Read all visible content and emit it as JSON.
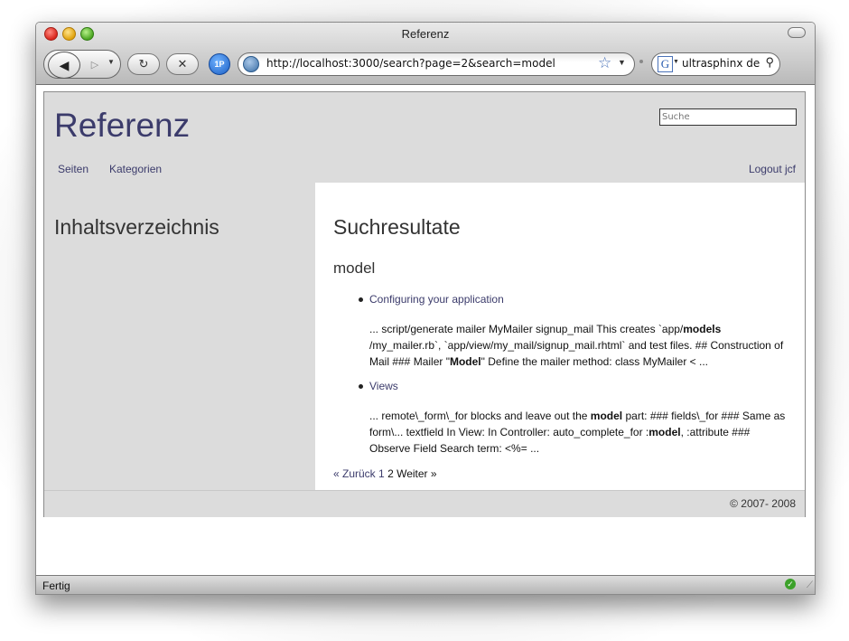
{
  "window": {
    "title": "Referenz",
    "status": "Fertig"
  },
  "toolbar": {
    "url": "http://localhost:3000/search?page=2&search=model",
    "search_value": "ultrasphinx de",
    "onepassword_label": "1P",
    "google_label": "G"
  },
  "site": {
    "logo": "Referenz",
    "search_placeholder": "Suche",
    "nav": {
      "seiten": "Seiten",
      "kategorien": "Kategorien",
      "logout": "Logout jcf"
    },
    "sidebar_title": "Inhaltsverzeichnis",
    "heading": "Suchresultate",
    "query": "model",
    "results": [
      {
        "title": "Configuring your application",
        "snippet_html": "... script/generate mailer MyMailer signup_mail This creates `app/<b>models</b> /my_mailer.rb`, `app/view/my_mail/signup_mail.rhtml` and test files. ## Construction of Mail ### Mailer \"<b>Model</b>\" Define the mailer method: class MyMailer &lt; ..."
      },
      {
        "title": "Views",
        "snippet_html": "... remote\\_form\\_for blocks and leave out the <b>model</b> part: ### fields\\_for ### Same as form\\... textfield In View: In Controller: auto_complete_for :<b>model</b>, :attribute ### Observe Field Search term: &lt;%= ..."
      }
    ],
    "pager": {
      "prev": "« Zurück",
      "page1": "1",
      "page2": "2",
      "next": "Weiter »"
    },
    "footer": "© 2007- 2008"
  },
  "colors": {
    "accent": "#3b3b6b",
    "header_bg": "#dcdcdc"
  }
}
